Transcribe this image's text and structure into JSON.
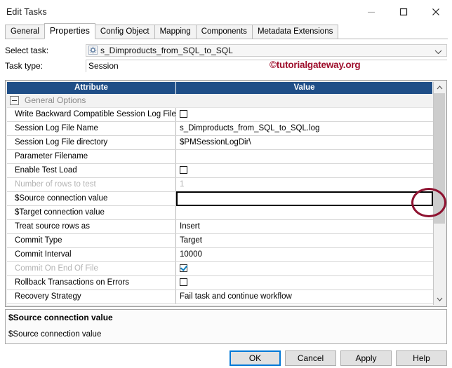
{
  "window": {
    "title": "Edit Tasks",
    "minimize_label": "minimize",
    "maximize_label": "maximize",
    "close_label": "close"
  },
  "tabs": [
    {
      "label": "General",
      "active": false
    },
    {
      "label": "Properties",
      "active": true
    },
    {
      "label": "Config Object",
      "active": false
    },
    {
      "label": "Mapping",
      "active": false
    },
    {
      "label": "Components",
      "active": false
    },
    {
      "label": "Metadata Extensions",
      "active": false
    }
  ],
  "form": {
    "select_task_label": "Select task:",
    "select_task_value": "s_Dimproducts_from_SQL_to_SQL",
    "task_type_label": "Task type:",
    "task_type_value": "Session"
  },
  "watermark": "©tutorialgateway.org",
  "grid": {
    "columns": [
      "Attribute",
      "Value"
    ],
    "rows": [
      {
        "attribute": "General Options",
        "value": "",
        "type": "section",
        "expanded": true
      },
      {
        "attribute": "Write Backward Compatible Session Log File",
        "value": "",
        "type": "checkbox",
        "checked": false
      },
      {
        "attribute": "Session Log File Name",
        "value": "s_Dimproducts_from_SQL_to_SQL.log",
        "type": "text"
      },
      {
        "attribute": "Session Log File directory",
        "value": "$PMSessionLogDir\\",
        "type": "text"
      },
      {
        "attribute": "Parameter Filename",
        "value": "",
        "type": "text"
      },
      {
        "attribute": "Enable Test Load",
        "value": "",
        "type": "checkbox",
        "checked": false
      },
      {
        "attribute": "Number of rows to test",
        "value": "1",
        "type": "text",
        "disabled": true
      },
      {
        "attribute": "$Source connection value",
        "value": "",
        "type": "dropdown",
        "editing": true
      },
      {
        "attribute": "$Target connection value",
        "value": "",
        "type": "text"
      },
      {
        "attribute": "Treat source rows as",
        "value": "Insert",
        "type": "text"
      },
      {
        "attribute": "Commit Type",
        "value": "Target",
        "type": "text"
      },
      {
        "attribute": "Commit Interval",
        "value": "10000",
        "type": "text"
      },
      {
        "attribute": "Commit On End Of File",
        "value": "",
        "type": "checkbox",
        "checked": true,
        "disabled": true
      },
      {
        "attribute": "Rollback Transactions on Errors",
        "value": "",
        "type": "checkbox",
        "checked": false
      },
      {
        "attribute": "Recovery Strategy",
        "value": "Fail task and continue workflow",
        "type": "text"
      }
    ],
    "scrollbar": {
      "up_arrow": "⌃",
      "down_arrow": "⌄"
    }
  },
  "description": {
    "title": "$Source connection value",
    "body": "$Source connection value"
  },
  "buttons": [
    {
      "label": "OK",
      "default": true
    },
    {
      "label": "Cancel",
      "default": false
    },
    {
      "label": "Apply",
      "default": false
    },
    {
      "label": "Help",
      "default": false
    }
  ],
  "colors": {
    "header_blue": "#1f4e87",
    "accent_blue": "#0078d7",
    "annotation_red": "#8e1230",
    "watermark_red": "#9e0f2c"
  }
}
